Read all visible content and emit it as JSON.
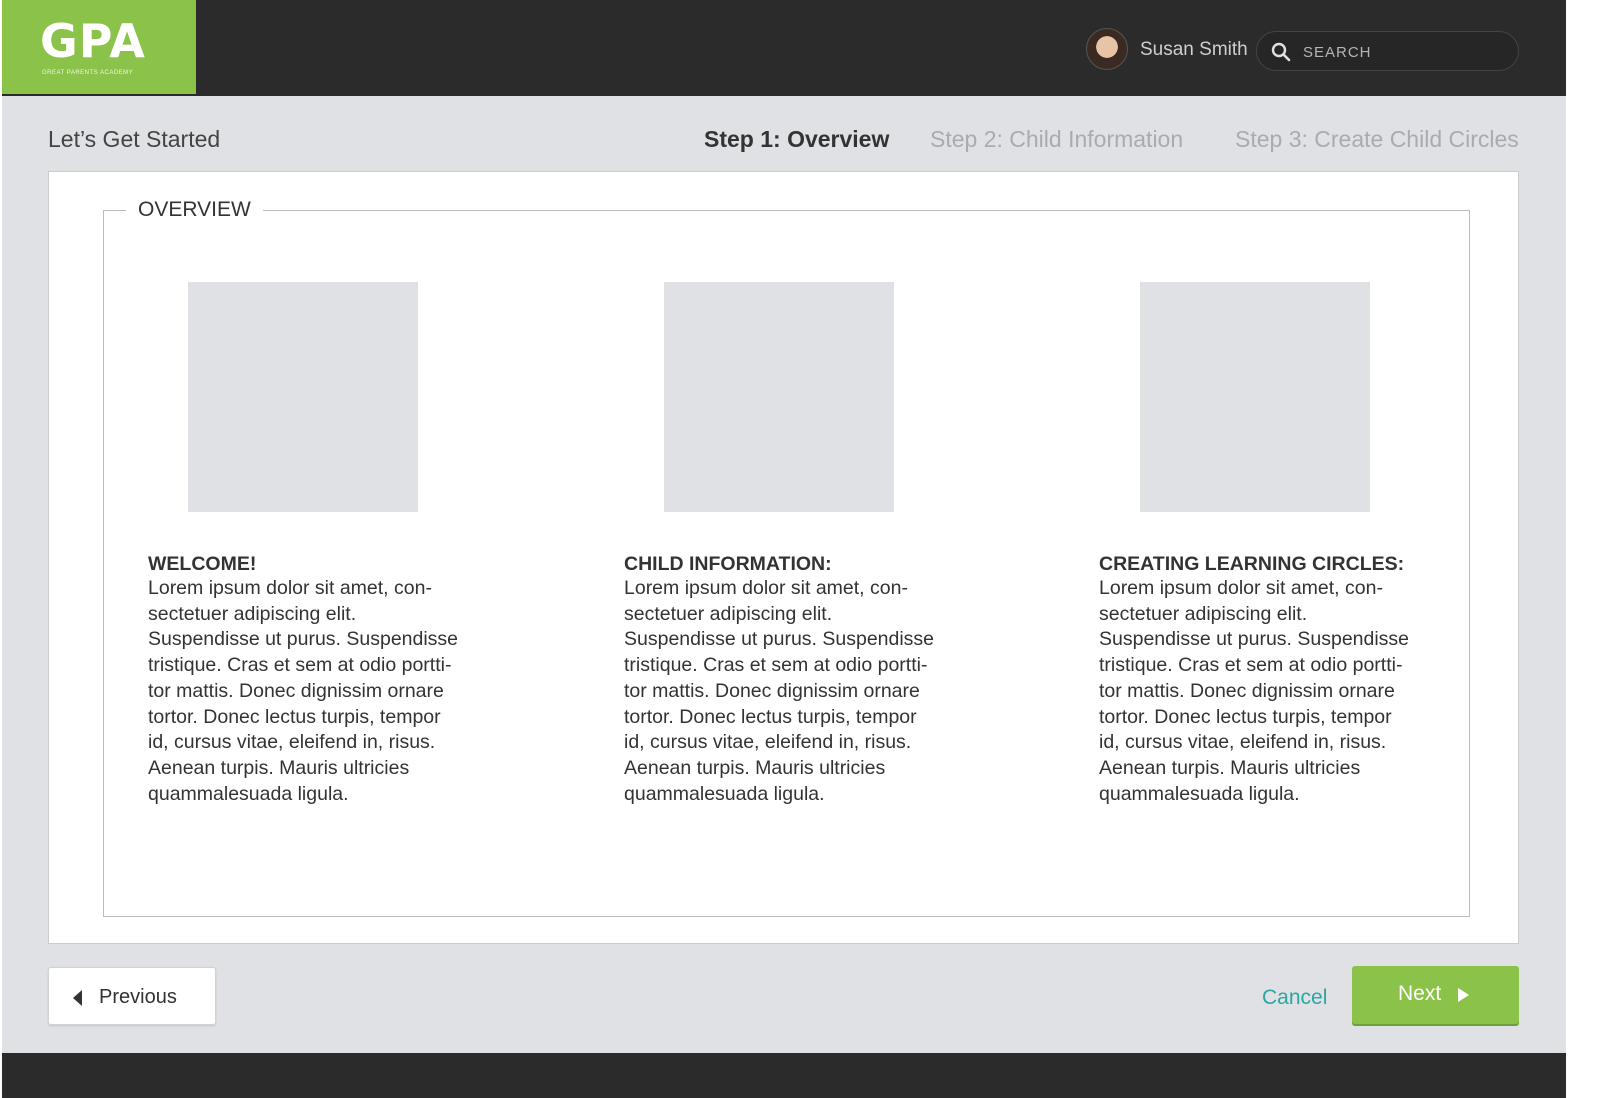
{
  "header": {
    "logo_text": "GPA",
    "logo_subtitle": "Great Parents Academy",
    "user_name": "Susan Smith",
    "search_placeholder": "SEARCH"
  },
  "wizard": {
    "title": "Let’s Get Started",
    "steps": [
      {
        "label": "Step 1: Overview",
        "active": true
      },
      {
        "label": "Step 2: Child Information",
        "active": false
      },
      {
        "label": "Step 3: Create Child Circles",
        "active": false
      }
    ]
  },
  "overview": {
    "legend": "OVERVIEW",
    "columns": [
      {
        "heading": "WELCOME!",
        "lines": [
          "Lorem ipsum dolor sit amet, con-",
          "sectetuer adipiscing elit.",
          "Suspendisse ut purus. Suspendisse",
          "tristique. Cras et sem at odio portti-",
          "tor mattis. Donec dignissim ornare",
          "tortor. Donec lectus turpis, tempor",
          "id, cursus vitae, eleifend in, risus.",
          "Aenean turpis. Mauris ultricies",
          "quammalesuada ligula."
        ]
      },
      {
        "heading": "CHILD INFORMATION:",
        "lines": [
          "Lorem ipsum dolor sit amet, con-",
          "sectetuer adipiscing elit.",
          "Suspendisse ut purus. Suspendisse",
          "tristique. Cras et sem at odio portti-",
          "tor mattis. Donec dignissim ornare",
          "tortor. Donec lectus turpis, tempor",
          "id, cursus vitae, eleifend in, risus.",
          "Aenean turpis. Mauris ultricies",
          "quammalesuada ligula."
        ]
      },
      {
        "heading": "CREATING LEARNING CIRCLES:",
        "lines": [
          "Lorem ipsum dolor sit amet, con-",
          "sectetuer adipiscing elit.",
          "Suspendisse ut purus. Suspendisse",
          "tristique. Cras et sem at odio portti-",
          "tor mattis. Donec dignissim ornare",
          "tortor. Donec lectus turpis, tempor",
          "id, cursus vitae, eleifend in, risus.",
          "Aenean turpis. Mauris ultricies",
          "quammalesuada ligula."
        ]
      }
    ]
  },
  "footer": {
    "previous_label": "Previous",
    "cancel_label": "Cancel",
    "next_label": "Next"
  },
  "colors": {
    "brand_green": "#8bc34a",
    "header_dark": "#2b2b2b",
    "page_bg": "#dfe1e5",
    "link_teal": "#2ba7a0"
  },
  "icons": [
    "search-icon",
    "caret-left-icon",
    "caret-right-icon"
  ]
}
